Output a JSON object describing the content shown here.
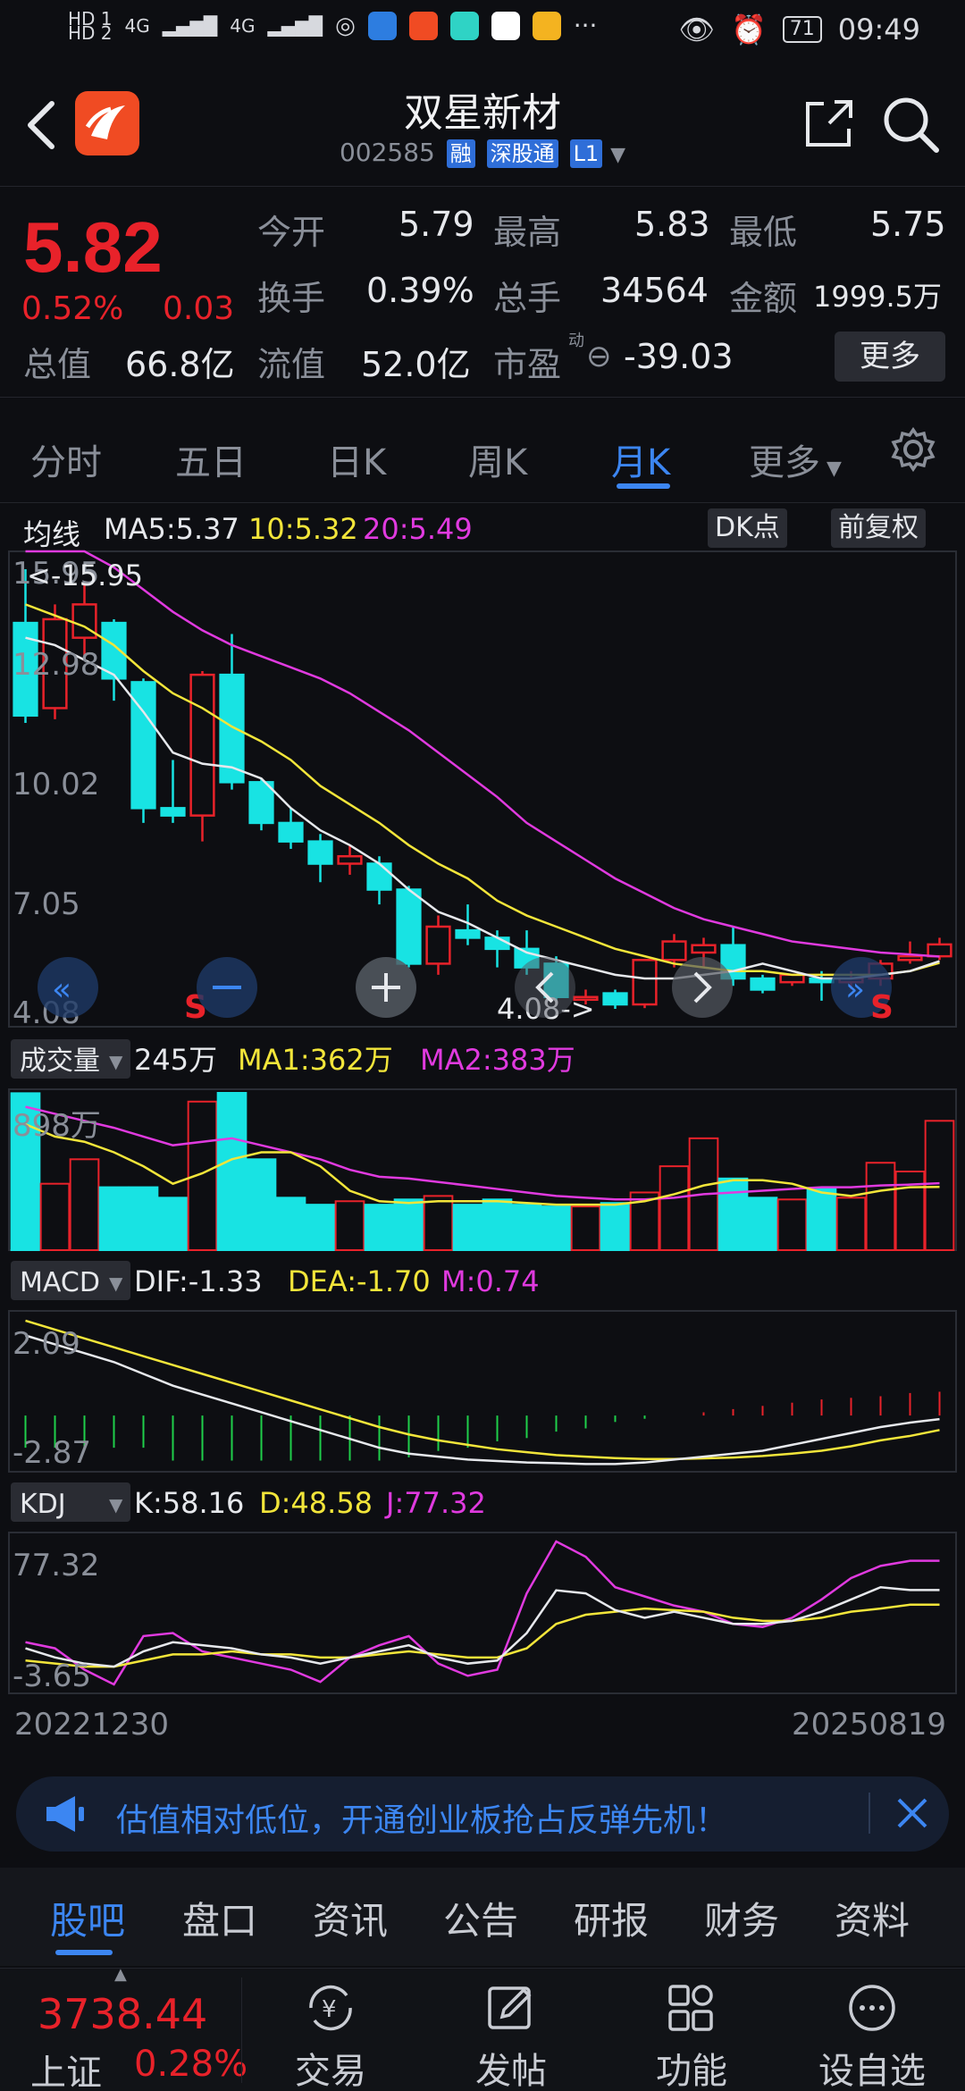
{
  "status": {
    "left_tags": [
      "HD 1",
      "HD 2",
      "4G",
      "4G"
    ],
    "more": "···",
    "battery": "71",
    "time": "09:49"
  },
  "header": {
    "name": "双星新材",
    "code": "002585",
    "tags": [
      "融",
      "深股通",
      "L1"
    ]
  },
  "quote": {
    "price": "5.82",
    "change_pct": "0.52%",
    "change": "0.03",
    "open_label": "今开",
    "open": "5.79",
    "high_label": "最高",
    "high": "5.83",
    "low_label": "最低",
    "low": "5.75",
    "turnover_label": "换手",
    "turnover": "0.39%",
    "volume_label": "总手",
    "volume": "34564",
    "amount_label": "金额",
    "amount": "1999.5万",
    "mcap_label": "总值",
    "mcap": "66.8亿",
    "float_label": "流值",
    "float": "52.0亿",
    "pe_label": "市盈",
    "pe_sup": "动",
    "pe": "-39.03",
    "more_button": "更多"
  },
  "tabs": [
    "分时",
    "五日",
    "日K",
    "周K",
    "月K",
    "更多"
  ],
  "active_tab": "月K",
  "ma_bar": {
    "label": "均线",
    "ma5": "MA5:5.37",
    "ma10": "10:5.32",
    "ma20": "20:5.49",
    "dk_button": "DK点",
    "adjust_button": "前复权"
  },
  "kline": {
    "max_label": "<-15.95",
    "min_label": "4.08->",
    "axis_labels": [
      "15.95",
      "12.98",
      "10.02",
      "7.05",
      "4.08"
    ],
    "sell_marks": [
      "S",
      "S"
    ]
  },
  "volume_bar": {
    "selector": "成交量",
    "value": "245万",
    "ma1": "MA1:362万",
    "ma2": "MA2:383万",
    "axis_max": "898万"
  },
  "macd_bar": {
    "selector": "MACD",
    "dif": "DIF:-1.33",
    "dea": "DEA:-1.70",
    "m": "M:0.74",
    "axis_labels": [
      "2.09",
      "-2.87"
    ]
  },
  "kdj_bar": {
    "selector": "KDJ",
    "k": "K:58.16",
    "d": "D:48.58",
    "j": "J:77.32",
    "axis_labels": [
      "77.32",
      "-3.65"
    ]
  },
  "date_range": {
    "start": "20221230",
    "end": "20250819"
  },
  "promo": {
    "text": "估值相对低位，开通创业板抢占反弹先机！"
  },
  "bottom_tabs": [
    "股吧",
    "盘口",
    "资讯",
    "公告",
    "研报",
    "财务",
    "资料"
  ],
  "bottom_nav": {
    "index_value": "3738.44",
    "index_name": "上证",
    "index_pct": "0.28%",
    "items": [
      "交易",
      "发帖",
      "功能",
      "设自选"
    ]
  },
  "chart_data": {
    "type": "candlestick",
    "period": "monthly",
    "price_range": [
      4.08,
      15.95
    ],
    "candles": [
      [
        14.5,
        12.0,
        15.95,
        11.8
      ],
      [
        12.2,
        14.6,
        15.0,
        11.9
      ],
      [
        14.1,
        15.0,
        15.6,
        13.6
      ],
      [
        14.5,
        13.0,
        14.6,
        12.4
      ],
      [
        12.9,
        9.5,
        13.0,
        9.1
      ],
      [
        9.5,
        9.3,
        10.8,
        9.1
      ],
      [
        9.3,
        13.1,
        13.2,
        8.6
      ],
      [
        13.1,
        10.2,
        14.2,
        10.0
      ],
      [
        10.2,
        9.1,
        10.3,
        8.9
      ],
      [
        9.1,
        8.6,
        9.5,
        8.4
      ],
      [
        8.6,
        8.0,
        8.8,
        7.5
      ],
      [
        8.0,
        8.2,
        8.5,
        7.7
      ],
      [
        8.0,
        7.3,
        8.2,
        6.9
      ],
      [
        7.3,
        5.3,
        7.4,
        5.2
      ],
      [
        5.3,
        6.3,
        6.6,
        5.0
      ],
      [
        6.2,
        6.0,
        6.9,
        5.8
      ],
      [
        6.0,
        5.7,
        6.2,
        5.2
      ],
      [
        5.7,
        5.2,
        6.2,
        5.0
      ],
      [
        5.3,
        4.4,
        5.5,
        4.3
      ],
      [
        4.4,
        4.4,
        4.6,
        4.2
      ],
      [
        4.5,
        4.2,
        4.6,
        4.08
      ],
      [
        4.2,
        5.4,
        5.4,
        4.1
      ],
      [
        5.4,
        5.9,
        6.1,
        5.2
      ],
      [
        5.6,
        5.8,
        6.0,
        5.2
      ],
      [
        5.8,
        4.9,
        6.3,
        4.7
      ],
      [
        4.9,
        4.6,
        5.0,
        4.5
      ],
      [
        4.8,
        5.0,
        5.0,
        4.7
      ],
      [
        4.9,
        4.8,
        5.1,
        4.3
      ],
      [
        4.8,
        4.9,
        5.1,
        4.6
      ],
      [
        4.9,
        5.3,
        5.4,
        4.7
      ],
      [
        5.4,
        5.5,
        5.9,
        5.3
      ],
      [
        5.5,
        5.82,
        6.0,
        5.4
      ]
    ],
    "ma5": [
      14.1,
      13.9,
      13.5,
      13.1,
      12.1,
      11.0,
      10.7,
      10.6,
      10.3,
      9.5,
      8.9,
      8.5,
      8.0,
      7.3,
      6.7,
      6.4,
      6.0,
      5.6,
      5.4,
      5.2,
      5.0,
      4.9,
      4.9,
      5.0,
      5.1,
      5.3,
      5.1,
      4.9,
      4.9,
      5.0,
      5.1,
      5.37
    ],
    "ma10": [
      15.0,
      14.7,
      14.4,
      13.9,
      13.2,
      12.6,
      12.2,
      11.7,
      11.3,
      10.8,
      10.1,
      9.6,
      9.1,
      8.5,
      8.0,
      7.6,
      7.0,
      6.6,
      6.3,
      6.0,
      5.7,
      5.5,
      5.3,
      5.2,
      5.1,
      5.1,
      5.0,
      5.0,
      5.0,
      5.0,
      5.1,
      5.32
    ],
    "ma20": [
      17.5,
      17.0,
      16.5,
      16.0,
      15.4,
      14.8,
      14.3,
      13.9,
      13.6,
      13.3,
      13.0,
      12.6,
      12.1,
      11.6,
      11.0,
      10.4,
      9.8,
      9.1,
      8.6,
      8.1,
      7.6,
      7.2,
      6.8,
      6.5,
      6.3,
      6.1,
      5.9,
      5.8,
      5.7,
      5.6,
      5.55,
      5.49
    ],
    "volume": [
      898,
      380,
      520,
      360,
      360,
      300,
      850,
      900,
      520,
      300,
      260,
      280,
      260,
      290,
      310,
      260,
      290,
      260,
      250,
      250,
      270,
      330,
      480,
      640,
      410,
      300,
      290,
      350,
      300,
      500,
      450,
      740
    ],
    "vol_ma1": [
      720,
      650,
      620,
      560,
      480,
      380,
      440,
      520,
      560,
      560,
      480,
      340,
      280,
      270,
      280,
      280,
      280,
      270,
      260,
      260,
      260,
      280,
      320,
      370,
      400,
      400,
      380,
      330,
      310,
      340,
      360,
      362
    ],
    "vol_ma2": [
      820,
      780,
      740,
      700,
      650,
      600,
      620,
      640,
      600,
      560,
      520,
      460,
      420,
      410,
      390,
      370,
      350,
      330,
      310,
      300,
      290,
      290,
      300,
      320,
      330,
      340,
      350,
      360,
      360,
      370,
      375,
      383
    ],
    "macd_dif": [
      1.5,
      1.2,
      0.9,
      0.6,
      0.2,
      -0.2,
      -0.5,
      -0.8,
      -1.1,
      -1.4,
      -1.7,
      -2.0,
      -2.3,
      -2.5,
      -2.6,
      -2.7,
      -2.75,
      -2.8,
      -2.82,
      -2.85,
      -2.85,
      -2.8,
      -2.7,
      -2.6,
      -2.5,
      -2.4,
      -2.2,
      -2.0,
      -1.8,
      -1.6,
      -1.45,
      -1.33
    ],
    "macd_dea": [
      2.0,
      1.7,
      1.4,
      1.1,
      0.8,
      0.5,
      0.2,
      -0.1,
      -0.4,
      -0.7,
      -1.0,
      -1.3,
      -1.6,
      -1.85,
      -2.05,
      -2.2,
      -2.35,
      -2.45,
      -2.55,
      -2.6,
      -2.65,
      -2.68,
      -2.68,
      -2.66,
      -2.63,
      -2.58,
      -2.5,
      -2.4,
      -2.25,
      -2.05,
      -1.9,
      -1.7
    ],
    "macd_m": [
      -1.0,
      -1.0,
      -1.0,
      -1.0,
      -1.0,
      -1.4,
      -1.4,
      -1.4,
      -1.4,
      -1.4,
      -1.4,
      -1.4,
      -1.4,
      -1.3,
      -1.1,
      -1.0,
      -0.8,
      -0.7,
      -0.5,
      -0.4,
      -0.2,
      -0.1,
      0.0,
      0.1,
      0.2,
      0.3,
      0.4,
      0.5,
      0.55,
      0.6,
      0.7,
      0.74
    ],
    "kdj_k": [
      20,
      14,
      10,
      8,
      18,
      24,
      22,
      20,
      16,
      14,
      10,
      14,
      18,
      22,
      14,
      10,
      12,
      30,
      58,
      56,
      45,
      40,
      44,
      40,
      36,
      36,
      38,
      44,
      52,
      60,
      58.16,
      58.16
    ],
    "kdj_d": [
      12,
      10,
      8,
      8,
      12,
      16,
      16,
      18,
      16,
      16,
      14,
      14,
      16,
      18,
      16,
      14,
      14,
      20,
      36,
      42,
      44,
      46,
      45,
      44,
      40,
      38,
      38,
      40,
      44,
      46,
      48.58,
      48.58
    ],
    "kdj_j": [
      24,
      20,
      6,
      -3.65,
      28,
      30,
      18,
      14,
      10,
      6,
      -2,
      14,
      22,
      28,
      10,
      2,
      6,
      56,
      90,
      80,
      60,
      54,
      48,
      44,
      36,
      34,
      40,
      52,
      66,
      74,
      77.32,
      77.32
    ]
  }
}
